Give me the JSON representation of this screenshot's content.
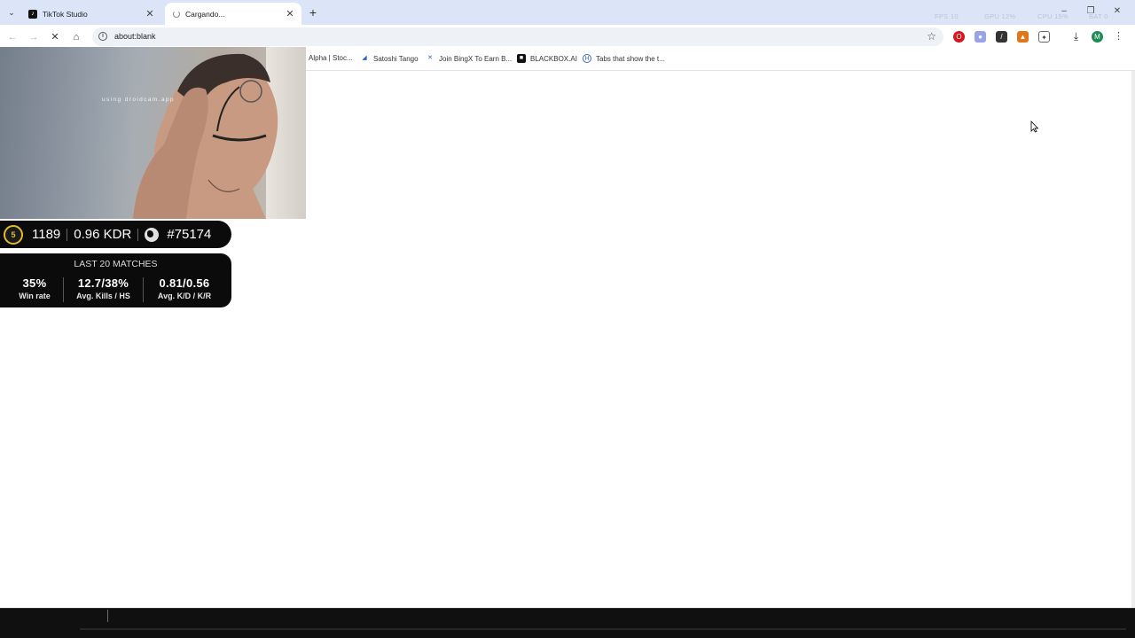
{
  "browser": {
    "tabs": [
      {
        "title": "TikTok Studio",
        "active": false
      },
      {
        "title": "Cargando...",
        "active": true
      }
    ],
    "address": "about:blank",
    "hud": {
      "fps_label": "FPS",
      "fps": "10",
      "gpu_label": "GPU",
      "gpu": "12%",
      "cpu_label": "CPU",
      "cpu": "15%",
      "bat_label": "BAT",
      "bat": "0"
    }
  },
  "bookmarks": [
    {
      "label": "Alpha | Stoc...",
      "icon": "document-icon"
    },
    {
      "label": "Satoshi Tango",
      "icon": "satoshi-icon"
    },
    {
      "label": "Join BingX To Earn B...",
      "icon": "bingx-icon"
    },
    {
      "label": "BLACKBOX.AI",
      "icon": "blackbox-icon"
    },
    {
      "label": "Tabs that show the t...",
      "icon": "h-icon"
    }
  ],
  "webcam": {
    "watermark": "using droidcam.app"
  },
  "faceit": {
    "level": "5",
    "elo": "1189",
    "kdr": "0.96 KDR",
    "rank": "#75174",
    "matches_heading": "LAST 20 MATCHES",
    "stats": [
      {
        "value": "35%",
        "label": "Win rate"
      },
      {
        "value": "12.7/38%",
        "label": "Avg. Kills / HS"
      },
      {
        "value": "0.81/0.56",
        "label": "Avg. K/D / K/R"
      }
    ]
  },
  "colors": {
    "tabstrip": "#dbe5f7",
    "level_ring": "#e4b92b",
    "overlay_bg": "#0b0b0b"
  }
}
